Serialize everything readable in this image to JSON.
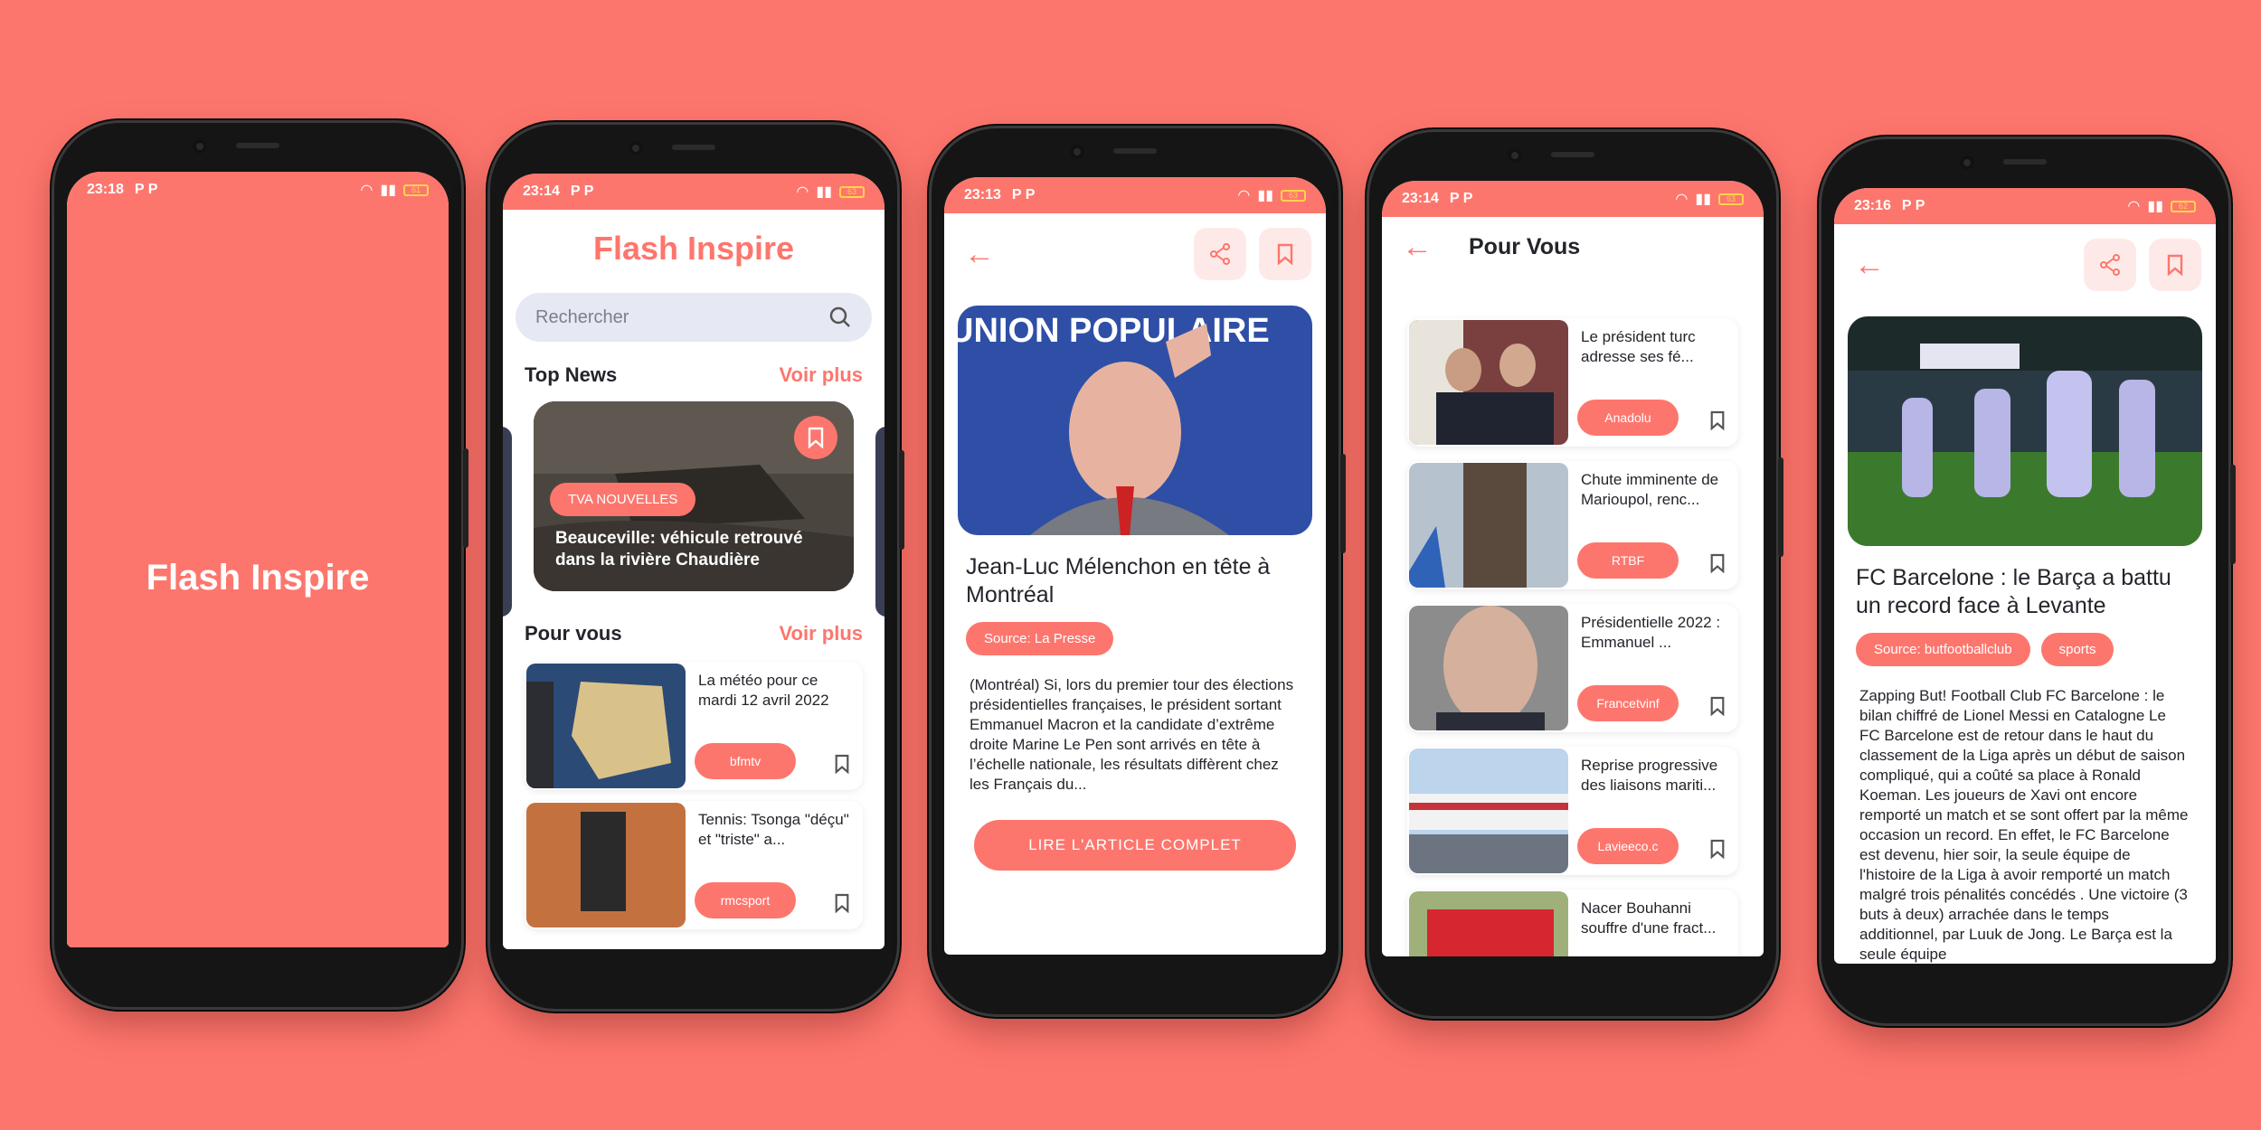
{
  "colors": {
    "accent": "#fd766d",
    "background": "#fd766d",
    "text": "#23252b"
  },
  "status": {
    "s1": {
      "time": "23:18",
      "battery": "61"
    },
    "s2": {
      "time": "23:14",
      "battery": "63"
    },
    "s3": {
      "time": "23:13",
      "battery": "63"
    },
    "s4": {
      "time": "23:14",
      "battery": "63"
    },
    "s5": {
      "time": "23:16",
      "battery": "62"
    },
    "status_icons": "P P"
  },
  "splash": {
    "title": "Flash Inspire"
  },
  "home": {
    "app_title": "Flash Inspire",
    "search_placeholder": "Rechercher",
    "top_news_label": "Top News",
    "top_news_more": "Voir plus",
    "top_card": {
      "source": "TVA NOUVELLES",
      "title": "Beauceville: véhicule retrouvé dans la rivière Chaudière"
    },
    "pour_vous_label": "Pour vous",
    "pour_vous_more": "Voir plus",
    "items": [
      {
        "title": "La météo pour ce mardi 12 avril 2022",
        "source": "bfmtv"
      },
      {
        "title": "Tennis: Tsonga \"déçu\" et \"triste\" a...",
        "source": "rmcsport"
      }
    ]
  },
  "article1": {
    "title": "Jean-Luc Mélenchon en tête à Montréal",
    "source_tag": "Source: La Presse",
    "body": "(Montréal) Si, lors du premier tour des élections présidentielles françaises, le président sortant Emmanuel Macron et la candidate d’extrême droite Marine Le Pen sont arrivés en tête à l’échelle nationale, les résultats diffèrent chez les Français du...",
    "read_button": "LIRE L'ARTICLE COMPLET",
    "hero_text": "UNION POPULAIRE"
  },
  "pourvous": {
    "title": "Pour Vous",
    "items": [
      {
        "title": "Le président turc adresse ses fé...",
        "source": "Anadolu"
      },
      {
        "title": "Chute imminente de Marioupol, renc...",
        "source": "RTBF"
      },
      {
        "title": "Présidentielle 2022 : Emmanuel ...",
        "source": "Francetvinf"
      },
      {
        "title": "Reprise progressive des liaisons mariti...",
        "source": "Lavieeco.c"
      },
      {
        "title": "Nacer Bouhanni souffre d'une fract...",
        "source": ""
      }
    ]
  },
  "article2": {
    "title": "FC Barcelone : le Barça a battu un record face à Levante",
    "tags": [
      "Source: butfootballclub",
      "sports"
    ],
    "body": "Zapping But! Football Club FC Barcelone : le bilan chiffré de Lionel Messi en Catalogne Le FC Barcelone est de retour dans le haut du classement de la Liga après un début de saison compliqué, qui a coûté sa place à Ronald Koeman. Les joueurs de Xavi ont encore remporté un match et se sont offert par la même occasion un record. En effet, le FC Barcelone est devenu, hier soir, la seule équipe de l'histoire de la Liga à avoir remporté un match malgré trois pénalités concédés . Une victoire (3 buts à deux) arrachée dans le temps additionnel, par Luuk de Jong. Le Barça est la seule équipe"
  }
}
